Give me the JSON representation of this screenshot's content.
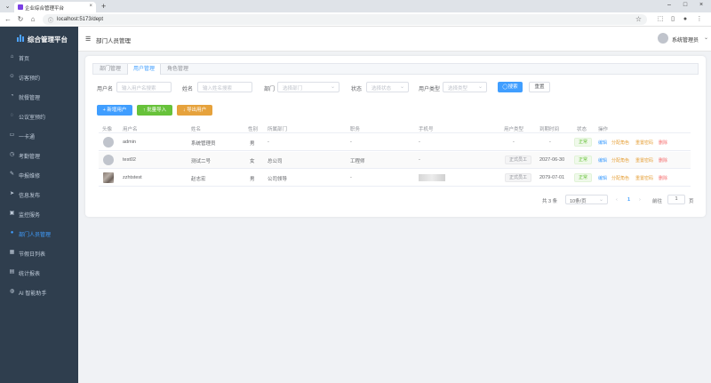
{
  "browser": {
    "tab_title": "企业综合管理平台",
    "url": "localhost:5173/dept"
  },
  "sidebar": {
    "brand": "综合管理平台",
    "items": [
      {
        "label": "首页",
        "icon": "home-icon"
      },
      {
        "label": "访客预约",
        "icon": "user-icon"
      },
      {
        "label": "就餐管理",
        "icon": "dish-icon"
      },
      {
        "label": "公议室预约",
        "icon": "chat-icon"
      },
      {
        "label": "一卡通",
        "icon": "card-icon"
      },
      {
        "label": "考勤管理",
        "icon": "clock-icon"
      },
      {
        "label": "申报维修",
        "icon": "wrench-icon"
      },
      {
        "label": "信息发布",
        "icon": "send-icon"
      },
      {
        "label": "监控服务",
        "icon": "monitor-icon"
      },
      {
        "label": "部门人员管理",
        "icon": "person-icon"
      },
      {
        "label": "节假日列表",
        "icon": "calendar-icon"
      },
      {
        "label": "统计报表",
        "icon": "report-icon"
      },
      {
        "label": "AI 智能助手",
        "icon": "ai-chat-icon"
      }
    ],
    "active_index": 9
  },
  "header": {
    "breadcrumb": "部门人员管理",
    "user": "系统管理员"
  },
  "tabs": [
    "部门管理",
    "用户管理",
    "角色管理"
  ],
  "filters": {
    "username_label": "用户名",
    "username_placeholder": "输入用户名搜索",
    "name_label": "姓名",
    "name_placeholder": "输入姓名搜索",
    "dept_label": "部门",
    "dept_placeholder": "选择部门",
    "status_label": "状态",
    "status_placeholder": "选择状态",
    "type_label": "用户类型",
    "type_placeholder": "选择类型",
    "search_button": "◯搜索",
    "reset_button": "重置"
  },
  "actions": {
    "add_user": "+ 新增用户",
    "batch_import": "↑ 批量导入",
    "export": "↓ 导出用户"
  },
  "table": {
    "headers": [
      "头像",
      "用户名",
      "姓名",
      "性别",
      "所属部门",
      "职务",
      "手机号",
      "用户类型",
      "到期时间",
      "状态",
      "操作"
    ],
    "rows": [
      {
        "username": "admin",
        "name": "系统管理员",
        "gender": "男",
        "dept": "-",
        "position": "-",
        "phone": "-",
        "type": "-",
        "expire": "-",
        "status": "正常",
        "avatar": "placeholder"
      },
      {
        "username": "test02",
        "name": "测试二号",
        "gender": "女",
        "dept": "总公司",
        "position": "工程师",
        "phone": "-",
        "type": "正式员工",
        "expire": "2027-06-30",
        "status": "正常",
        "avatar": "placeholder"
      },
      {
        "username": "zzhtstest",
        "name": "赵志宏",
        "gender": "男",
        "dept": "公司领导",
        "position": "-",
        "phone": "",
        "type": "正式员工",
        "expire": "2079-07-01",
        "status": "正常",
        "avatar": "photo"
      }
    ],
    "row_actions": [
      "编辑",
      "分配角色",
      "重置密码",
      "删除"
    ]
  },
  "pagination": {
    "total": "共 3 条",
    "page_size": "10条/页",
    "current_page": "1",
    "goto_label": "前往",
    "goto_value": "1",
    "page_suffix": "页"
  },
  "colors": {
    "sidebar_bg": "#2f3e4e",
    "accent": "#409eff",
    "success": "#67c23a",
    "warning": "#e6a23c",
    "danger": "#f56c6c"
  }
}
